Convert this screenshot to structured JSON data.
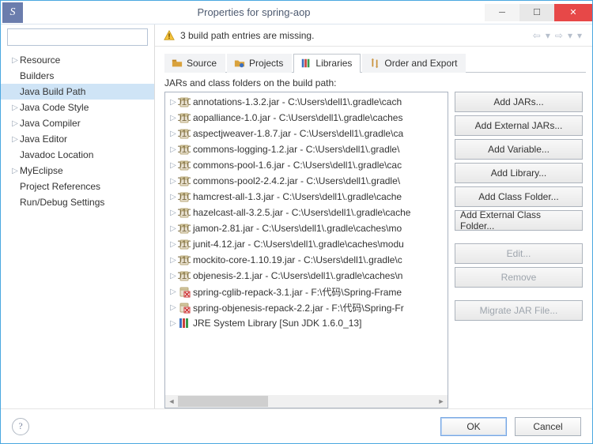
{
  "window": {
    "title": "Properties for spring-aop"
  },
  "warn": {
    "message": "3 build path entries are missing."
  },
  "nav": {
    "items": [
      {
        "label": "Resource",
        "expandable": true
      },
      {
        "label": "Builders",
        "expandable": false
      },
      {
        "label": "Java Build Path",
        "expandable": false,
        "selected": true
      },
      {
        "label": "Java Code Style",
        "expandable": true
      },
      {
        "label": "Java Compiler",
        "expandable": true
      },
      {
        "label": "Java Editor",
        "expandable": true
      },
      {
        "label": "Javadoc Location",
        "expandable": false
      },
      {
        "label": "MyEclipse",
        "expandable": true
      },
      {
        "label": "Project References",
        "expandable": false
      },
      {
        "label": "Run/Debug Settings",
        "expandable": false
      }
    ]
  },
  "tabs": {
    "items": [
      {
        "label": "Source",
        "icon": "source"
      },
      {
        "label": "Projects",
        "icon": "projects"
      },
      {
        "label": "Libraries",
        "icon": "libraries",
        "active": true
      },
      {
        "label": "Order and Export",
        "icon": "order"
      }
    ]
  },
  "listLabel": "JARs and class folders on the build path:",
  "jars": [
    {
      "label": "annotations-1.3.2.jar - C:\\Users\\dell1\\.gradle\\cach",
      "type": "jar"
    },
    {
      "label": "aopalliance-1.0.jar - C:\\Users\\dell1\\.gradle\\caches",
      "type": "jar"
    },
    {
      "label": "aspectjweaver-1.8.7.jar - C:\\Users\\dell1\\.gradle\\ca",
      "type": "jar"
    },
    {
      "label": "commons-logging-1.2.jar - C:\\Users\\dell1\\.gradle\\",
      "type": "jar"
    },
    {
      "label": "commons-pool-1.6.jar - C:\\Users\\dell1\\.gradle\\cac",
      "type": "jar"
    },
    {
      "label": "commons-pool2-2.4.2.jar - C:\\Users\\dell1\\.gradle\\",
      "type": "jar"
    },
    {
      "label": "hamcrest-all-1.3.jar - C:\\Users\\dell1\\.gradle\\cache",
      "type": "jar"
    },
    {
      "label": "hazelcast-all-3.2.5.jar - C:\\Users\\dell1\\.gradle\\cache",
      "type": "jar"
    },
    {
      "label": "jamon-2.81.jar - C:\\Users\\dell1\\.gradle\\caches\\mo",
      "type": "jar"
    },
    {
      "label": "junit-4.12.jar - C:\\Users\\dell1\\.gradle\\caches\\modu",
      "type": "jar"
    },
    {
      "label": "mockito-core-1.10.19.jar - C:\\Users\\dell1\\.gradle\\c",
      "type": "jar"
    },
    {
      "label": "objenesis-2.1.jar - C:\\Users\\dell1\\.gradle\\caches\\n",
      "type": "jar"
    },
    {
      "label": "spring-cglib-repack-3.1.jar - F:\\代码\\Spring-Frame",
      "type": "jar-missing"
    },
    {
      "label": "spring-objenesis-repack-2.2.jar - F:\\代码\\Spring-Fr",
      "type": "jar-missing"
    },
    {
      "label": "JRE System Library [Sun JDK 1.6.0_13]",
      "type": "jre"
    }
  ],
  "buttons": {
    "addJars": "Add JARs...",
    "addExtJars": "Add External JARs...",
    "addVar": "Add Variable...",
    "addLib": "Add Library...",
    "addClassFolder": "Add Class Folder...",
    "addExtClassFolder": "Add External Class Folder...",
    "edit": "Edit...",
    "remove": "Remove",
    "migrate": "Migrate JAR File..."
  },
  "footer": {
    "ok": "OK",
    "cancel": "Cancel"
  }
}
